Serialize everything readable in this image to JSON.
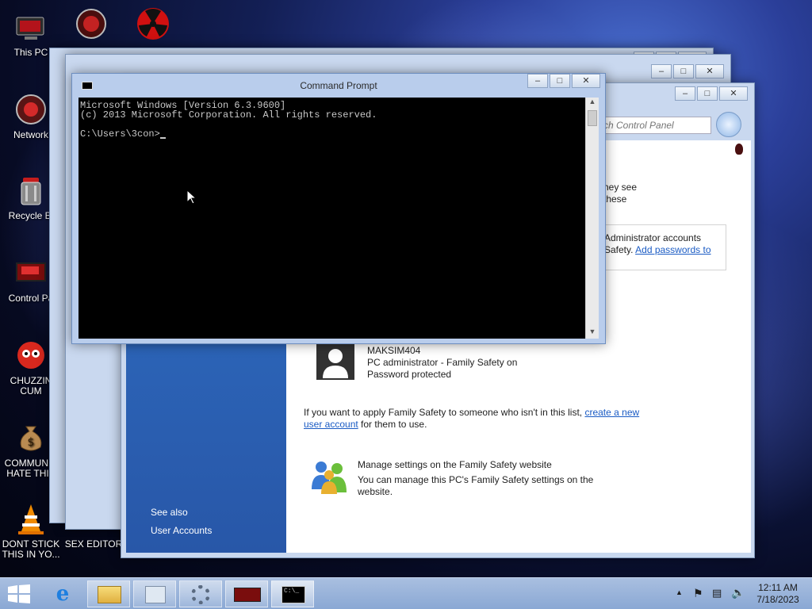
{
  "desktop": {
    "icons": [
      {
        "label": "This PC",
        "icon": "this-pc-icon"
      },
      {
        "label": "Network",
        "icon": "network-icon"
      },
      {
        "label": "Recycle Bi",
        "icon": "recycle-bin-icon"
      },
      {
        "label": "Control Pa",
        "icon": "control-panel-icon"
      },
      {
        "label": "CHUZZIN\nCUM",
        "icon": "chuzzle-icon"
      },
      {
        "label": "COMMUNIS\nHATE THIS",
        "icon": "money-bag-icon"
      },
      {
        "label": "DONT STICK\nTHIS IN YO...",
        "icon": "vlc-cone-icon"
      },
      {
        "label": "SEX EDITOR",
        "icon": "editor-icon"
      }
    ]
  },
  "control_panel": {
    "search_placeholder": "rch Control Panel",
    "text_they_see": "hey see",
    "text_these": "these",
    "notice_line1": "Administrator accounts",
    "notice_line2_text": "Safety. ",
    "notice_link": "Add passwords to",
    "user": {
      "name": "MAKSIM404",
      "role": "PC administrator - Family Safety on",
      "password": "Password protected"
    },
    "apply_text_before": "If you want to apply Family Safety to someone who isn't in this list, ",
    "apply_link": "create a new user account",
    "apply_text_after": " for them to use.",
    "manage_title": "Manage settings on the Family Safety website",
    "manage_desc": "You can manage this PC's Family Safety settings on the website.",
    "see_also": "See also",
    "user_accounts": "User Accounts"
  },
  "cmd": {
    "title": "Command Prompt",
    "lines": [
      "Microsoft Windows [Version 6.3.9600]",
      "(c) 2013 Microsoft Corporation. All rights reserved.",
      "",
      "C:\\Users\\3con>"
    ]
  },
  "taskbar": {
    "time": "12:11 AM",
    "date": "7/18/2023"
  }
}
